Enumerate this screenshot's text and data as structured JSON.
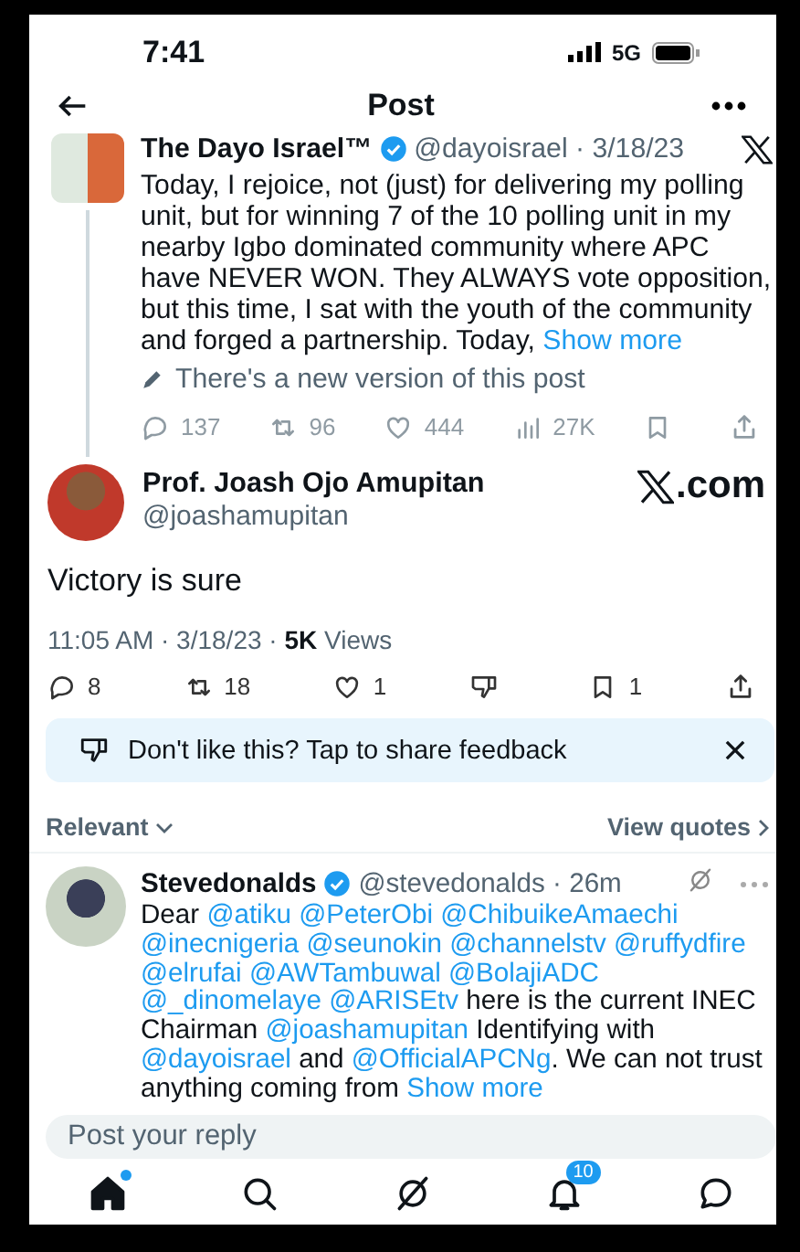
{
  "status_bar": {
    "time": "7:41",
    "network": "5G"
  },
  "header": {
    "title": "Post"
  },
  "quoted_post": {
    "author": "The Dayo Israel™",
    "verified": true,
    "handle": "@dayoisrael · 3/18/23",
    "text": "Today, I rejoice, not (just) for delivering my polling unit, but for winning 7 of the 10 polling unit in my nearby Igbo dominated community where APC have NEVER WON. They ALWAYS vote opposition, but this time, I sat with the youth of the community and forged a partnership. Today,",
    "show_more": "Show more",
    "edit_notice": "There's a new version of this post",
    "stats": [
      {
        "kind": "reply",
        "count": "137"
      },
      {
        "kind": "repost",
        "count": "96"
      },
      {
        "kind": "like",
        "count": "444"
      },
      {
        "kind": "views",
        "count": "27K"
      },
      {
        "kind": "bookmark"
      },
      {
        "kind": "share"
      }
    ]
  },
  "post": {
    "author": "Prof. Joash Ojo Amupitan",
    "handle": "@joashamupitan",
    "source": ".com",
    "text": "Victory is sure",
    "meta": "11:05 AM · 3/18/23 · **5K** Views",
    "actions": [
      {
        "kind": "reply",
        "count": "8"
      },
      {
        "kind": "repost",
        "count": "18"
      },
      {
        "kind": "like",
        "count": "1"
      },
      {
        "kind": "dislike"
      },
      {
        "kind": "bookmark",
        "count": "1"
      },
      {
        "kind": "share"
      }
    ]
  },
  "feedback": {
    "text": "Don't like this? Tap to share feedback"
  },
  "sort": {
    "label": "Relevant",
    "link": "View quotes"
  },
  "reply": {
    "author": "Stevedonalds",
    "verified": true,
    "handle": "@stevedonalds · 26m",
    "segments": [
      {
        "kind": "plain",
        "text": "Dear"
      },
      {
        "kind": "mention",
        "text": "@atiku"
      },
      {
        "kind": "mention",
        "text": "@PeterObi"
      },
      {
        "kind": "mention",
        "text": "@ChibuikeAmaechi"
      },
      {
        "kind": "mention",
        "text": "@inecnigeria"
      },
      {
        "kind": "mention",
        "text": "@seunokin"
      },
      {
        "kind": "mention",
        "text": "@channelstv"
      },
      {
        "kind": "mention",
        "text": "@ruffydfire"
      },
      {
        "kind": "mention",
        "text": "@elrufai"
      },
      {
        "kind": "mention",
        "text": "@AWTambuwal"
      },
      {
        "kind": "mention",
        "text": "@BolajiADC"
      },
      {
        "kind": "mention",
        "text": "@_dinomelaye"
      },
      {
        "kind": "mention",
        "text": "@ARISEtv"
      },
      {
        "kind": "plain",
        "text": "here is the current INEC Chairman"
      },
      {
        "kind": "mention",
        "text": "@joashamupitan"
      },
      {
        "kind": "plain",
        "text": "Identifying with"
      },
      {
        "kind": "mention",
        "text": "@dayoisrael"
      },
      {
        "kind": "plain",
        "text": "and"
      },
      {
        "kind": "mention",
        "text": "@OfficialAPCNg"
      },
      {
        "kind": "plain",
        "text": ". We can not trust anything coming from"
      },
      {
        "kind": "more",
        "text": "Show more"
      }
    ]
  },
  "composer": {
    "placeholder": "Post your reply"
  },
  "tab_bar": [
    {
      "kind": "home",
      "selected": true,
      "dot": true
    },
    {
      "kind": "search",
      "selected": false,
      "dot": false
    },
    {
      "kind": "grok",
      "selected": false,
      "dot": false
    },
    {
      "kind": "notifications",
      "selected": false,
      "dot": false,
      "badge": "10"
    },
    {
      "kind": "messages",
      "selected": false,
      "dot": false
    }
  ]
}
